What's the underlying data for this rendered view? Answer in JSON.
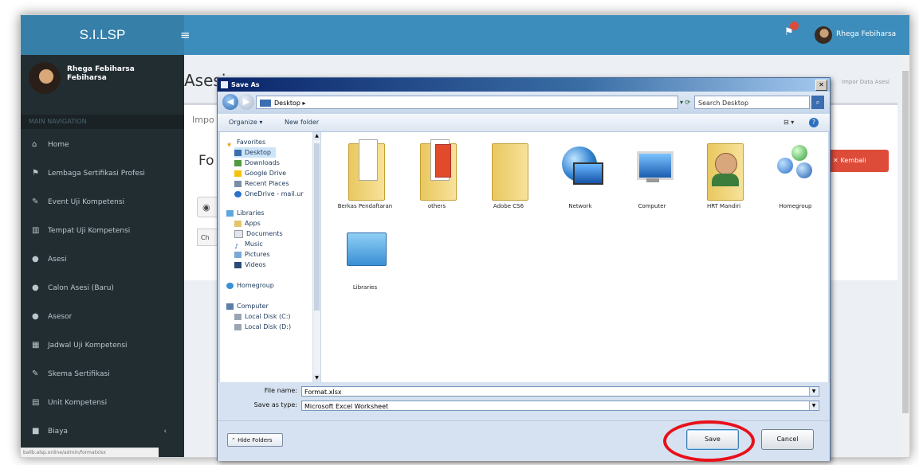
{
  "app": {
    "logo": "S.I.LSP",
    "header_user": "Rhega Febiharsa",
    "status_url": "ballb.alsp.online/admin/formatxlsx"
  },
  "sidebar": {
    "user_name": "Rhega Febiharsa Febiharsa",
    "nav_header": "MAIN NAVIGATION",
    "items": [
      {
        "label": "Home",
        "icon": "home-icon"
      },
      {
        "label": "Lembaga Sertifikasi Profesi",
        "icon": "flag-icon"
      },
      {
        "label": "Event Uji Kompetensi",
        "icon": "edit-icon"
      },
      {
        "label": "Tempat Uji Kompetensi",
        "icon": "bank-icon"
      },
      {
        "label": "Asesi",
        "icon": "users-icon"
      },
      {
        "label": "Calon Asesi (Baru)",
        "icon": "users-icon"
      },
      {
        "label": "Asesor",
        "icon": "users-icon"
      },
      {
        "label": "Jadwal Uji Kompetensi",
        "icon": "calendar-icon"
      },
      {
        "label": "Skema Sertifikasi",
        "icon": "edit-icon"
      },
      {
        "label": "Unit Kompetensi",
        "icon": "file-icon"
      },
      {
        "label": "Biaya",
        "icon": "folder-icon"
      }
    ]
  },
  "page": {
    "title": "Asesi",
    "breadcrumb": "Impor Data Asesi",
    "box_title": "Impo",
    "form_heading": "Fo",
    "button_radio": "◉",
    "button_choose": "Ch",
    "back_button": "Kembali"
  },
  "dialog": {
    "title": "Save As",
    "address": "Desktop",
    "search_placeholder": "Search Desktop",
    "organize": "Organize ▾",
    "new_folder": "New folder",
    "nav": {
      "favorites": "Favorites",
      "fav_items": [
        "Desktop",
        "Downloads",
        "Google Drive",
        "Recent Places",
        "OneDrive - mail.ur"
      ],
      "libraries": "Libraries",
      "lib_items": [
        "Apps",
        "Documents",
        "Music",
        "Pictures",
        "Videos"
      ],
      "homegroup": "Homegroup",
      "computer": "Computer",
      "drives": [
        "Local Disk (C:)",
        "Local Disk (D:)"
      ]
    },
    "files": [
      {
        "label": "Berkas Pendaftaran",
        "icon": "folder-documents-icon"
      },
      {
        "label": "others",
        "icon": "folder-red-icon"
      },
      {
        "label": "Adobe CS6",
        "icon": "folder-icon"
      },
      {
        "label": "Network",
        "icon": "network-globe-icon"
      },
      {
        "label": "Computer",
        "icon": "computer-icon"
      },
      {
        "label": "HRT Mandiri",
        "icon": "user-folder-icon"
      },
      {
        "label": "Homegroup",
        "icon": "homegroup-icon"
      },
      {
        "label": "Libraries",
        "icon": "libraries-icon"
      }
    ],
    "file_name_label": "File name:",
    "file_name_value": "Format.xlsx",
    "save_as_type_label": "Save as type:",
    "save_as_type_value": "Microsoft Excel Worksheet",
    "hide_folders": "Hide Folders",
    "save": "Save",
    "cancel": "Cancel"
  },
  "highlight": {
    "color": "#e8101a",
    "target": "save-button"
  }
}
